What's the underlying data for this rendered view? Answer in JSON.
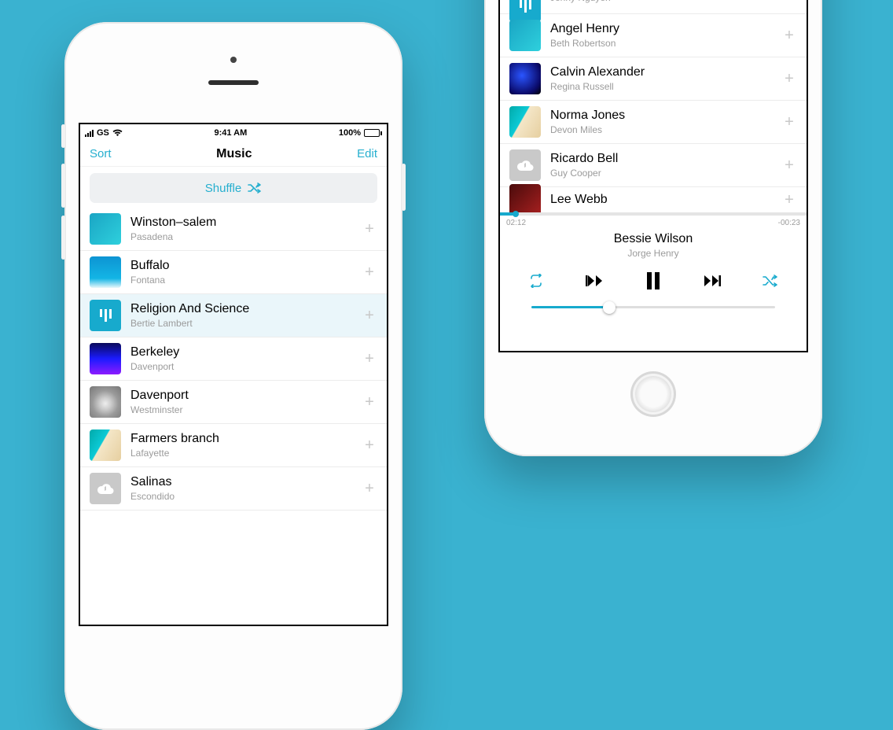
{
  "status": {
    "carrier": "GS",
    "time": "9:41 AM",
    "battery_label": "100%"
  },
  "left": {
    "nav": {
      "left": "Sort",
      "title": "Music",
      "right": "Edit"
    },
    "shuffle_label": "Shuffle",
    "tracks": [
      {
        "title": "Winston–salem",
        "subtitle": "Pasadena",
        "art": "art-teal"
      },
      {
        "title": "Buffalo",
        "subtitle": "Fontana",
        "art": "art-water"
      },
      {
        "title": "Religion And Science",
        "subtitle": "Bertie Lambert",
        "art": "art-eq",
        "active": true
      },
      {
        "title": "Berkeley",
        "subtitle": "Davenport",
        "art": "art-bluepurple"
      },
      {
        "title": "Davenport",
        "subtitle": "Westminster",
        "art": "art-cat"
      },
      {
        "title": "Farmers branch",
        "subtitle": "Lafayette",
        "art": "art-beach"
      },
      {
        "title": "Salinas",
        "subtitle": "Escondido",
        "art": "art-cloud"
      }
    ]
  },
  "right": {
    "tracks": [
      {
        "title": "",
        "subtitle": "Jenny Nguyen",
        "art": "art-eq",
        "partial_top": true
      },
      {
        "title": "Angel Henry",
        "subtitle": "Beth Robertson",
        "art": "art-teal"
      },
      {
        "title": "Calvin Alexander",
        "subtitle": "Regina Russell",
        "art": "art-stage"
      },
      {
        "title": "Norma Jones",
        "subtitle": "Devon Miles",
        "art": "art-beach"
      },
      {
        "title": "Ricardo Bell",
        "subtitle": "Guy Cooper",
        "art": "art-cloud"
      },
      {
        "title": "Lee Webb",
        "subtitle": "",
        "art": "art-red",
        "partial_bottom": true
      }
    ],
    "now_playing": {
      "elapsed": "02:12",
      "remaining": "-00:23",
      "progress_pct": 5,
      "title": "Bessie Wilson",
      "subtitle": "Jorge Henry",
      "volume_pct": 32
    }
  },
  "accent": "#17aacd"
}
